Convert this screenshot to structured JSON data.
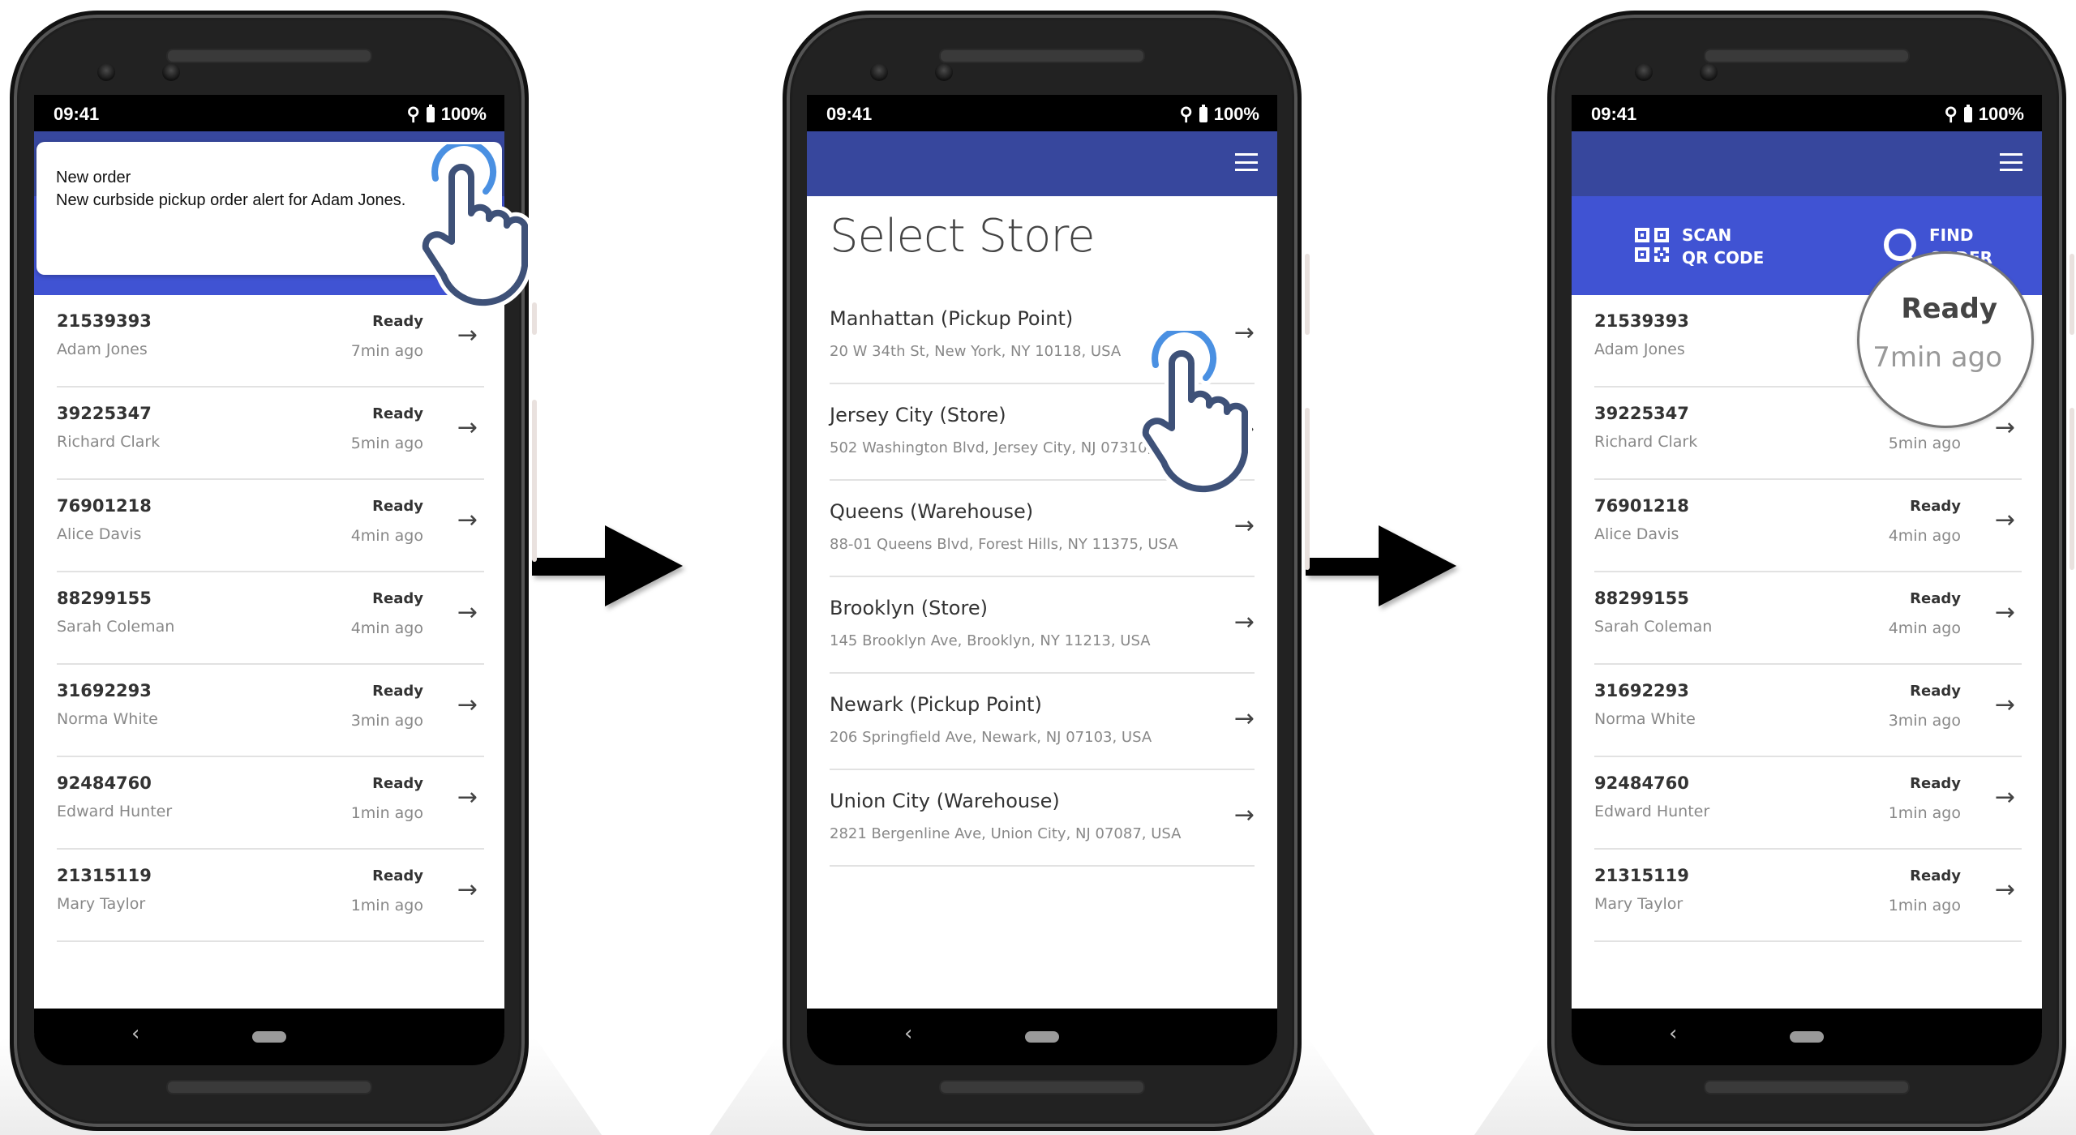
{
  "status_bar": {
    "time": "09:41",
    "battery": "100%",
    "location_icon": "location-pin-icon",
    "battery_icon": "battery-icon"
  },
  "colors": {
    "appbar": "#37479d",
    "actionbar": "#4053d3",
    "tap_ring": "#4a90e2",
    "hand_outline": "#3e5178"
  },
  "actions": {
    "scan_line1": "SCAN",
    "scan_line2": "QR CODE",
    "find_line1": "FIND",
    "find_line2": "ORDER"
  },
  "notification": {
    "title": "New order",
    "body": "New curbside pickup order alert for Adam Jones."
  },
  "orders": [
    {
      "id": "21539393",
      "name": "Adam Jones",
      "status": "Ready",
      "ago": "7min ago"
    },
    {
      "id": "39225347",
      "name": "Richard Clark",
      "status": "Ready",
      "ago": "5min ago"
    },
    {
      "id": "76901218",
      "name": "Alice Davis",
      "status": "Ready",
      "ago": "4min ago"
    },
    {
      "id": "88299155",
      "name": "Sarah Coleman",
      "status": "Ready",
      "ago": "4min ago"
    },
    {
      "id": "31692293",
      "name": "Norma White",
      "status": "Ready",
      "ago": "3min ago"
    },
    {
      "id": "92484760",
      "name": "Edward Hunter",
      "status": "Ready",
      "ago": "1min ago"
    },
    {
      "id": "21315119",
      "name": "Mary Taylor",
      "status": "Ready",
      "ago": "1min ago"
    }
  ],
  "select_store": {
    "title": "Select Store",
    "stores": [
      {
        "name": "Manhattan (Pickup Point)",
        "address": "20 W 34th St, New York, NY 10118, USA"
      },
      {
        "name": "Jersey City (Store)",
        "address": "502 Washington Blvd, Jersey City, NJ 07310, USA"
      },
      {
        "name": "Queens (Warehouse)",
        "address": "88-01 Queens Blvd, Forest Hills, NY 11375, USA"
      },
      {
        "name": "Brooklyn (Store)",
        "address": "145 Brooklyn Ave, Brooklyn, NY 11213, USA"
      },
      {
        "name": "Newark (Pickup Point)",
        "address": "206 Springfield Ave, Newark, NJ 07103, USA"
      },
      {
        "name": "Union City (Warehouse)",
        "address": "2821 Bergenline Ave, Union City, NJ 07087, USA"
      }
    ]
  },
  "magnifier": {
    "status": "Ready",
    "ago": "7min ago"
  },
  "glyphs": {
    "arrow": "→",
    "back": "‹"
  }
}
